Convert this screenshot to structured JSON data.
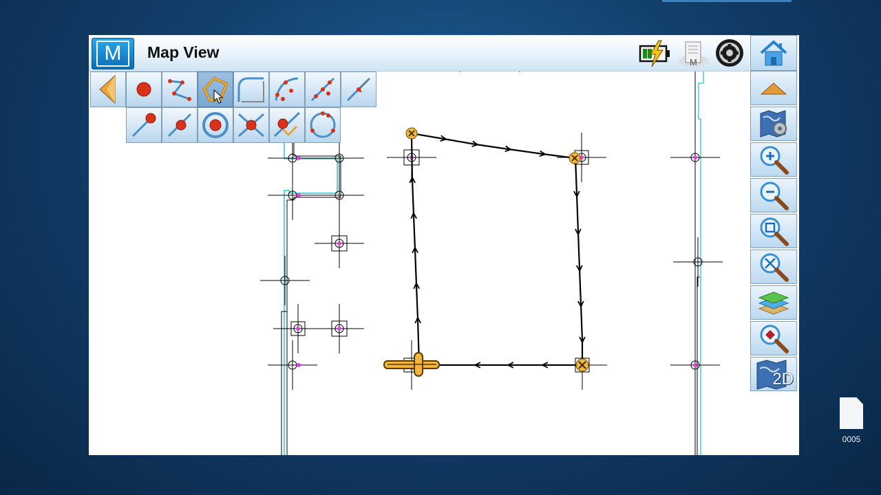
{
  "window": {
    "title": "Map View",
    "logo_letter": "M"
  },
  "titlebar_icons": [
    "battery-charging-icon",
    "controller-memory-icon",
    "sync-prism-icon",
    "home-icon"
  ],
  "sidebar": {
    "items": [
      {
        "name": "scroll-up-icon",
        "label": ""
      },
      {
        "name": "map-settings-icon",
        "label": ""
      },
      {
        "name": "zoom-in-icon",
        "label": ""
      },
      {
        "name": "zoom-out-icon",
        "label": ""
      },
      {
        "name": "zoom-window-icon",
        "label": ""
      },
      {
        "name": "zoom-extents-icon",
        "label": ""
      },
      {
        "name": "layers-icon",
        "label": ""
      },
      {
        "name": "zoom-point-icon",
        "label": ""
      },
      {
        "name": "view-2d-icon",
        "label": "2D"
      }
    ]
  },
  "toolbar": {
    "row1": [
      "back-arrow-icon",
      "point-icon",
      "polyline-icon",
      "polygon-icon",
      "fillet-icon",
      "arc-3point-icon",
      "line-points-icon",
      "intersect-lines-icon"
    ],
    "row2": [
      "line-end-point-icon",
      "line-point-icon",
      "circle-center-icon",
      "intersection-point-icon",
      "offset-point-icon",
      "circle-points-icon"
    ],
    "selected": "polygon-icon"
  },
  "desktop": {
    "file_name": "0005"
  },
  "colors": {
    "accent": "#1e8fd6",
    "highlight": "#f2b63c",
    "point_magenta": "#e040e0",
    "boundary_cyan": "#26c6d6"
  }
}
